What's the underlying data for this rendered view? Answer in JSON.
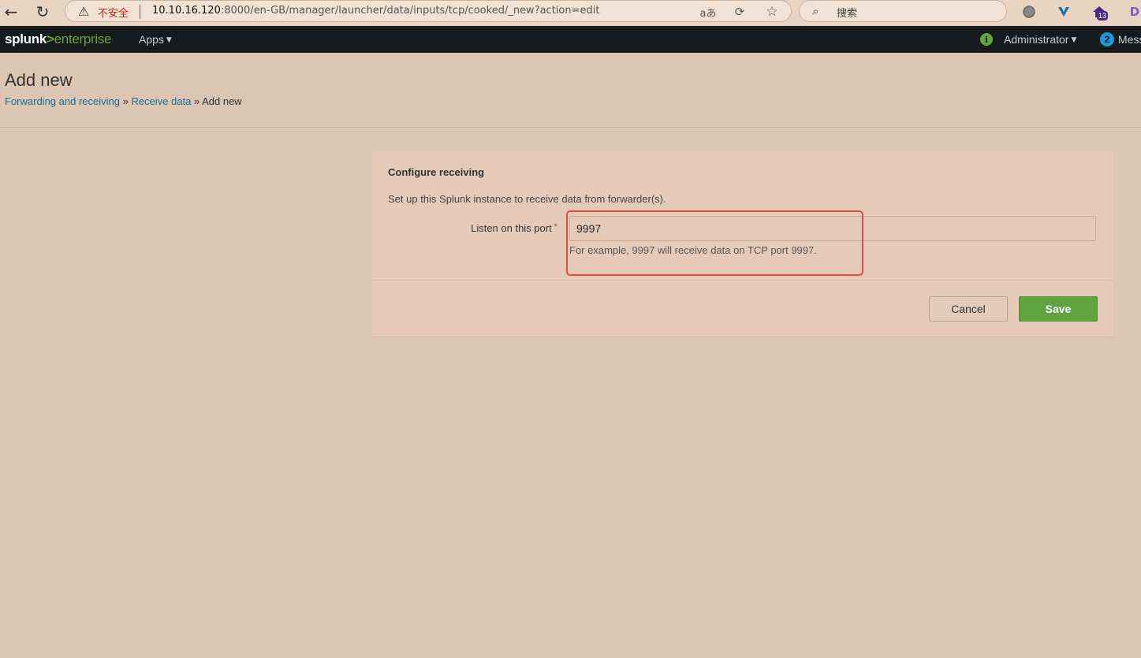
{
  "browser": {
    "back_icon": "arrow-left-icon",
    "reload_icon": "reload-icon",
    "security_warning": "不安全",
    "url_host": "10.10.16.120",
    "url_path": ":8000/en-GB/manager/launcher/data/inputs/tcp/cooked/_new?action=edit",
    "search_placeholder": "搜索",
    "ext_badge_count": "13"
  },
  "splunk_nav": {
    "logo_splunk": "splunk",
    "logo_gt": ">",
    "logo_enterprise": "enterprise",
    "apps_label": "Apps",
    "user_label": "Administrator",
    "messages_count": "2",
    "messages_label": "Mess"
  },
  "page": {
    "title": "Add new",
    "breadcrumb": {
      "items": [
        "Forwarding and receiving",
        "Receive data"
      ],
      "separator": "»",
      "current": "Add new"
    }
  },
  "form": {
    "title": "Configure receiving",
    "description": "Set up this Splunk instance to receive data from forwarder(s).",
    "port_label": "Listen on this port",
    "required_mark": "*",
    "port_value": "9997",
    "help_text": "For example, 9997 will receive data on TCP port 9997.",
    "cancel_label": "Cancel",
    "save_label": "Save"
  },
  "colors": {
    "accent_green": "#65a637",
    "save_button": "#5ea43e",
    "highlight_red": "#e8484a",
    "link_blue": "#1e6b93"
  }
}
